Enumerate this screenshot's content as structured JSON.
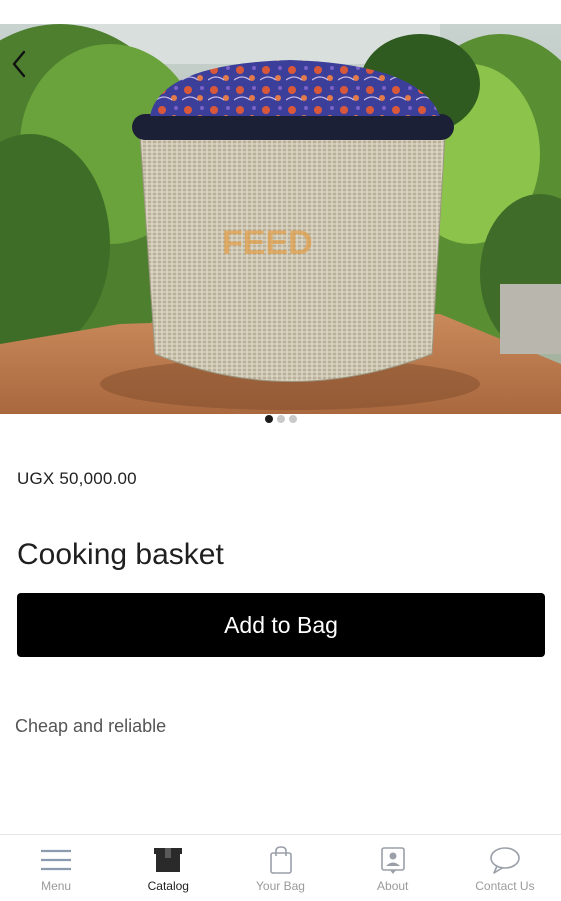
{
  "product": {
    "image_alt": "Cooking basket",
    "watermark": "FEED",
    "price": "UGX 50,000.00",
    "title": "Cooking basket",
    "add_to_bag_label": "Add to Bag",
    "description": "Cheap and reliable",
    "carousel": {
      "count": 3,
      "active": 1
    }
  },
  "icons": {
    "back": "chevron-left-icon",
    "menu": "menu-icon",
    "catalog": "box-icon",
    "bag": "shopping-bag-icon",
    "about": "contact-card-icon",
    "contact": "chat-bubble-icon"
  },
  "nav": {
    "menu_label": "Menu",
    "catalog_label": "Catalog",
    "bag_label": "Your Bag",
    "about_label": "About",
    "contact_label": "Contact Us",
    "active": "Catalog"
  },
  "colors": {
    "button_bg": "#000000",
    "button_text": "#ffffff",
    "nav_inactive": "#9a9a9a",
    "nav_active": "#222222",
    "dot_active": "#1a1a1a",
    "dot_inactive": "#c9c9c9"
  }
}
